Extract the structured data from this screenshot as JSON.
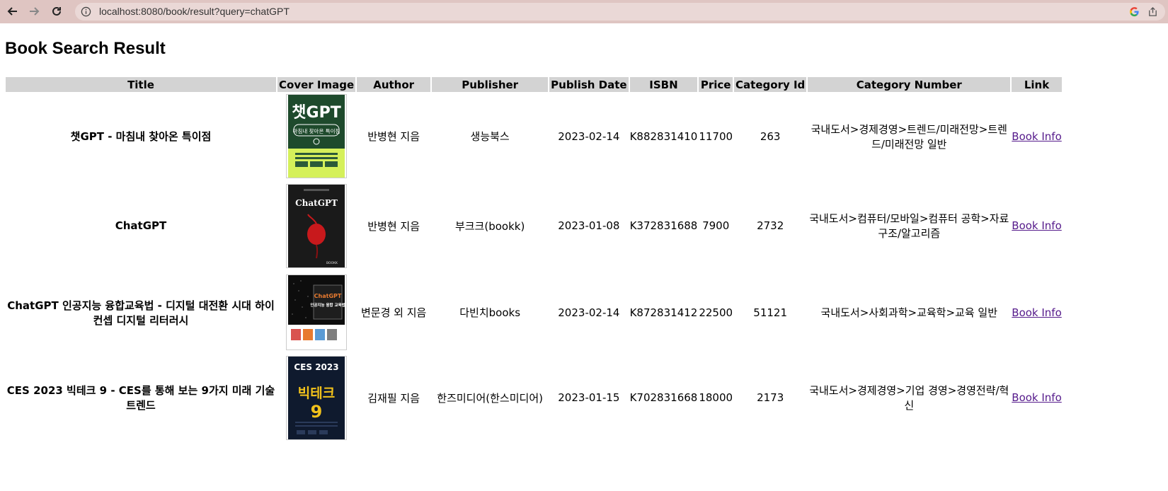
{
  "browser": {
    "url": "localhost:8080/book/result?query=chatGPT"
  },
  "page": {
    "title": "Book Search Result"
  },
  "table": {
    "headers": [
      "Title",
      "Cover Image",
      "Author",
      "Publisher",
      "Publish Date",
      "ISBN",
      "Price",
      "Category Id",
      "Category Number",
      "Link"
    ],
    "rows": [
      {
        "title": "챗GPT - 마침내 찾아온 특이점",
        "cover": {
          "bg": "#1e4a2c",
          "accent": "#d5f05a",
          "text_main": "챗GPT",
          "text_sub": "마침내 찾아온 특이점"
        },
        "author": "반병현 지음",
        "publisher": "생능북스",
        "publish_date": "2023-02-14",
        "isbn": "K882831410",
        "price": "11700",
        "category_id": "263",
        "category_number": "국내도서>경제경영>트렌드/미래전망>트렌드/미래전망 일반",
        "link": "Book Info"
      },
      {
        "title": "ChatGPT",
        "cover": {
          "bg": "#1a1a1a",
          "accent": "#c8191c",
          "text_main": "ChatGPT",
          "text_sub": "",
          "footer": "BOOKK"
        },
        "author": "반병현 지음",
        "publisher": "부크크(bookk)",
        "publish_date": "2023-01-08",
        "isbn": "K372831688",
        "price": "7900",
        "category_id": "2732",
        "category_number": "국내도서>컴퓨터/모바일>컴퓨터 공학>자료구조/알고리즘",
        "link": "Book Info"
      },
      {
        "title": "ChatGPT 인공지능 융합교육법 - 디지털 대전환 시대 하이컨셉 디지털 리터러시",
        "cover": {
          "bg": "#0d0d0d",
          "accent": "#e87a2f",
          "text_main": "ChatGPT",
          "text_sub": "인공지능 융합 교육법"
        },
        "author": "변문경 외 지음",
        "publisher": "다빈치books",
        "publish_date": "2023-02-14",
        "isbn": "K872831412",
        "price": "22500",
        "category_id": "51121",
        "category_number": "국내도서>사회과학>교육학>교육 일반",
        "link": "Book Info"
      },
      {
        "title": "CES 2023 빅테크 9 - CES를 통해 보는 9가지 미래 기술 트렌드",
        "cover": {
          "bg": "#0f1a2e",
          "accent": "#f2c21b",
          "text_main": "빅테크",
          "text_sub": "CES 2023",
          "big": "9"
        },
        "author": "김재필 지음",
        "publisher": "한즈미디어(한스미디어)",
        "publish_date": "2023-01-15",
        "isbn": "K702831668",
        "price": "18000",
        "category_id": "2173",
        "category_number": "국내도서>경제경영>기업 경영>경영전략/혁신",
        "link": "Book Info"
      }
    ]
  }
}
